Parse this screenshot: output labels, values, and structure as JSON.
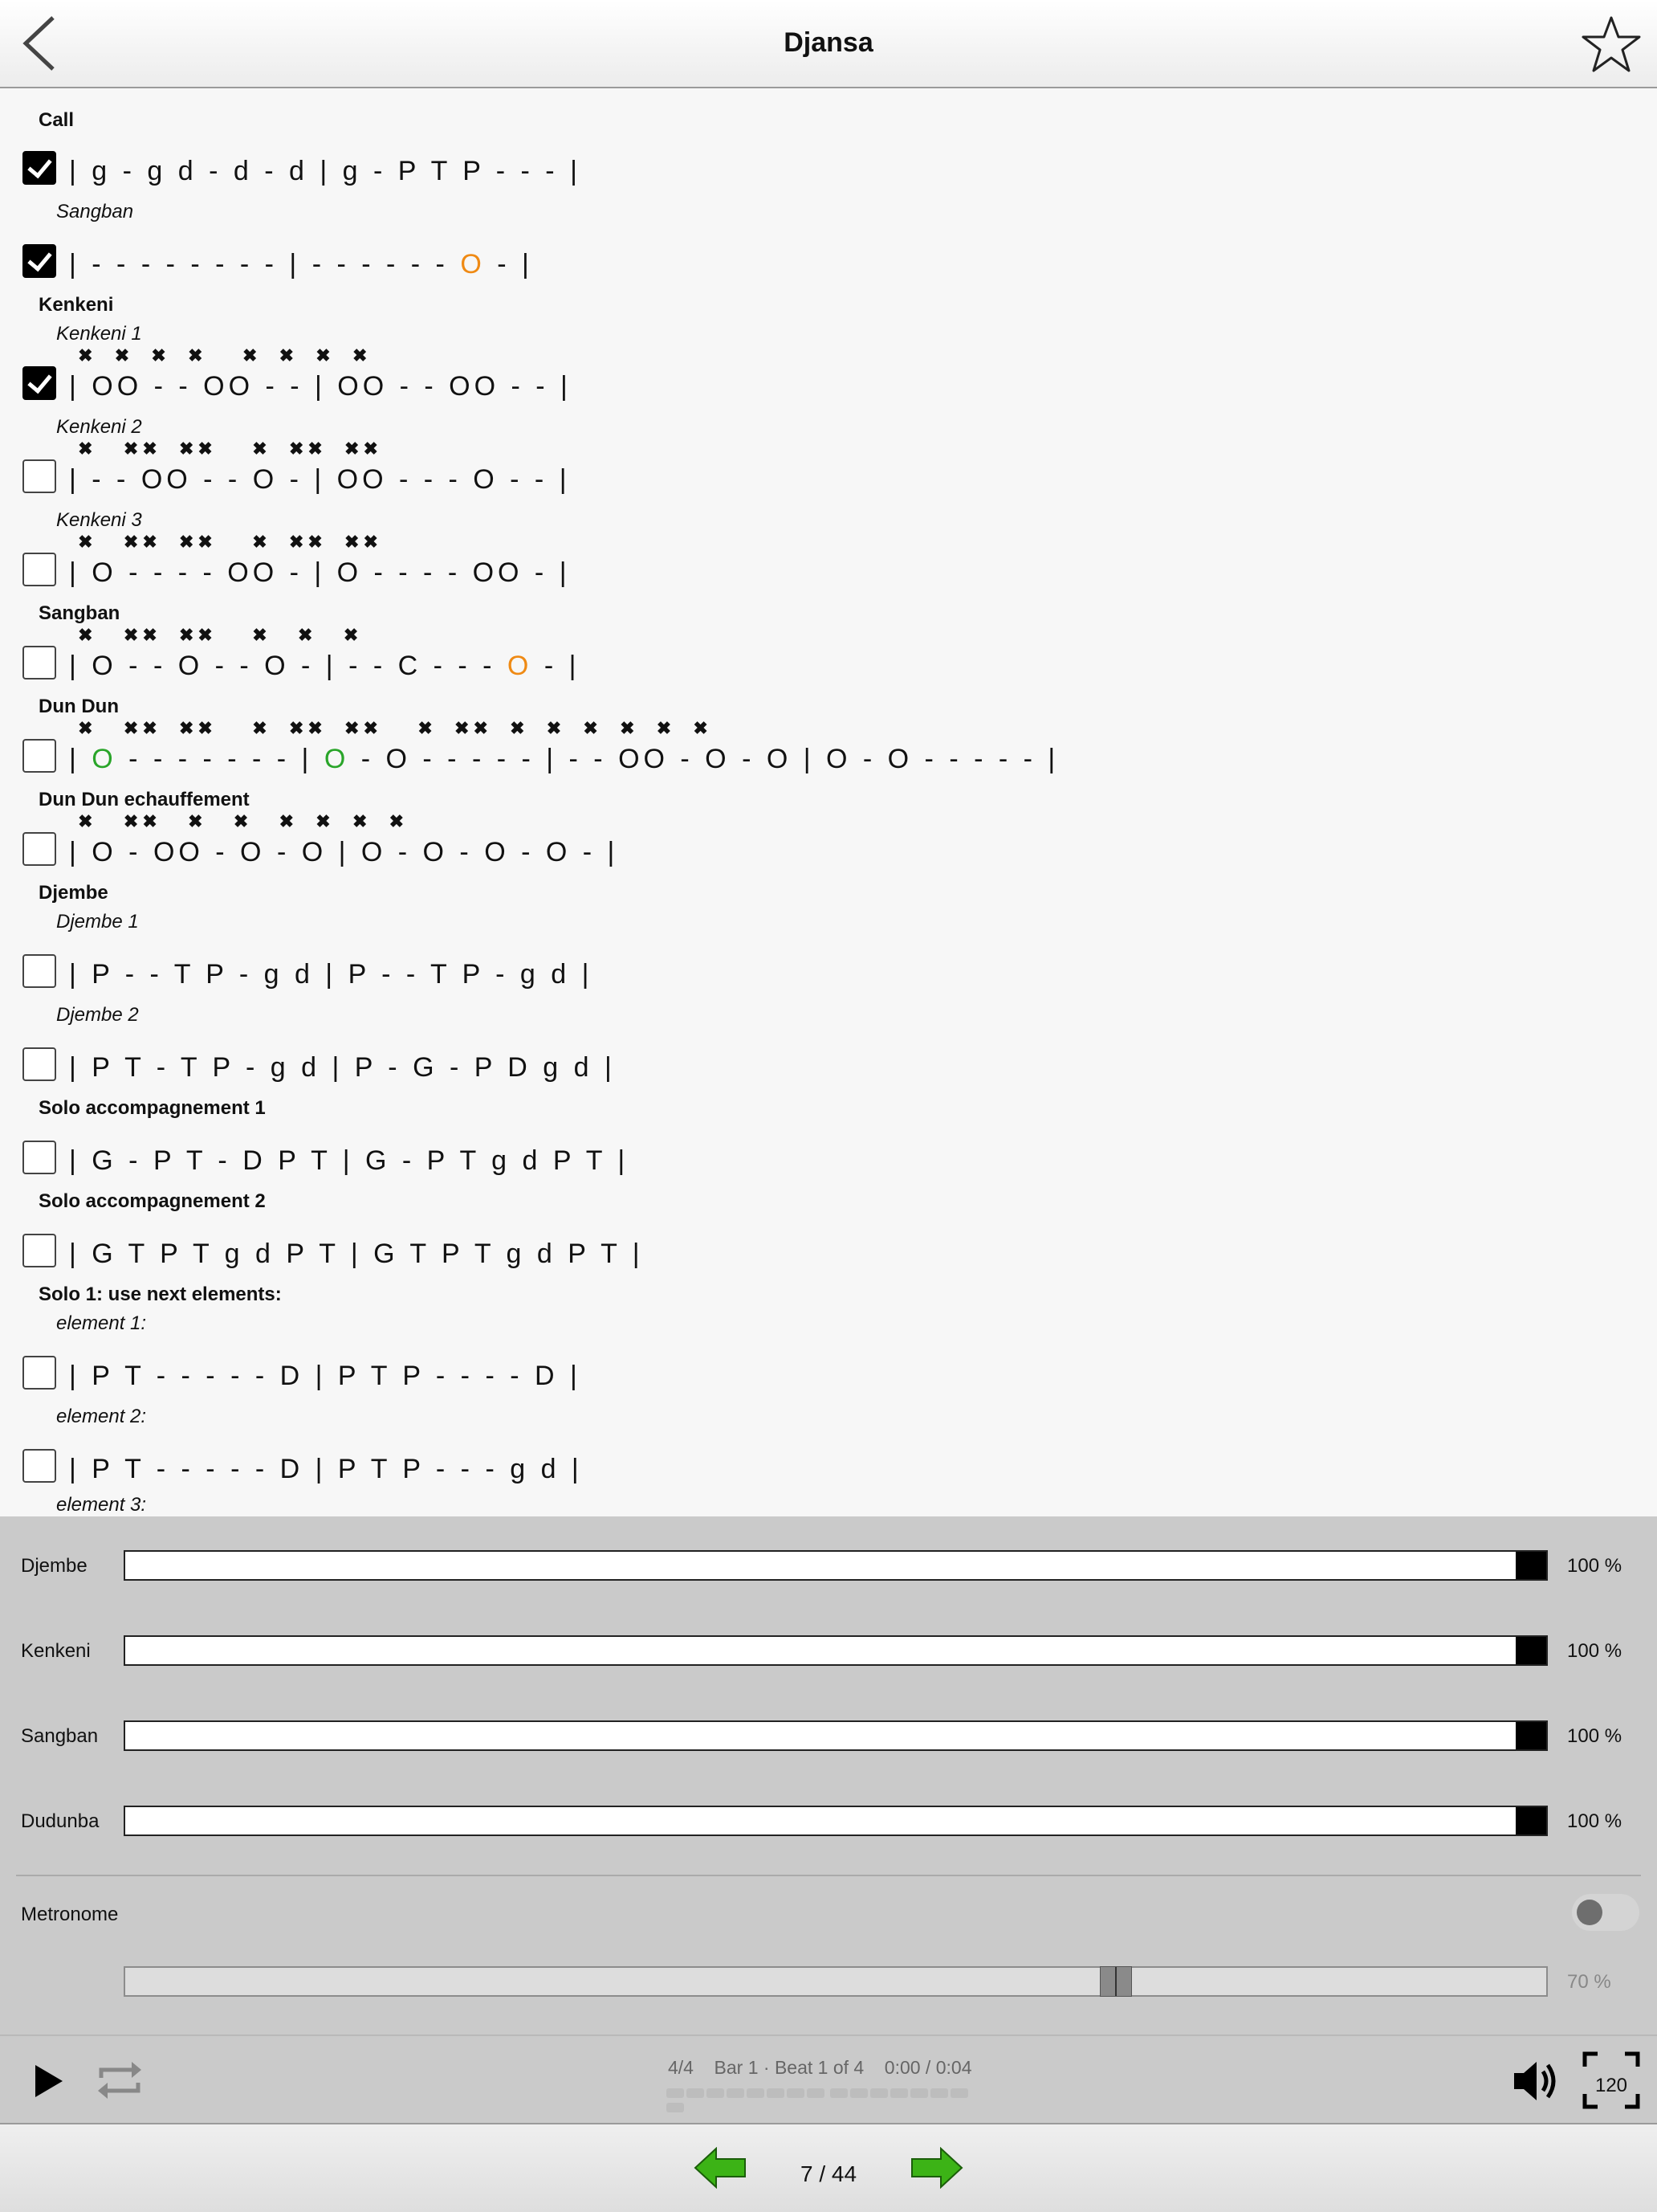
{
  "header": {
    "title": "Djansa"
  },
  "content": {
    "titles": {
      "call": "Call",
      "call_sub": "Sangban",
      "kenkeni": "Kenkeni",
      "kenkeni1": "Kenkeni 1",
      "kenkeni2": "Kenkeni 2",
      "kenkeni3": "Kenkeni 3",
      "sangban": "Sangban",
      "dundun": "Dun Dun",
      "dundun_ech": "Dun Dun echauffement",
      "djembe": "Djembe",
      "djembe1": "Djembe 1",
      "djembe2": "Djembe 2",
      "solo_acc1": "Solo accompagnement 1",
      "solo_acc2": "Solo accompagnement 2",
      "solo1": "Solo 1: use next elements:",
      "element1": "element 1:",
      "element2": "element 2:",
      "element3": "element 3:"
    },
    "rows": [
      {
        "checked": true,
        "marks": "",
        "pattern": "| g - g d - d - d | g - P T P - - - |"
      },
      {
        "checked": true,
        "marks": "",
        "pattern": "| - - - - - - - - | - - - - - - ",
        "orange": "O",
        "tail": " - |"
      },
      {
        "checked": true,
        "marks": " ✖  ✖  ✖  ✖    ✖  ✖  ✖  ✖",
        "pattern": "| OO - - OO - - | OO - - OO - - |"
      },
      {
        "checked": false,
        "marks": " ✖   ✖✖  ✖✖    ✖  ✖✖  ✖✖",
        "pattern": "| - - OO - - O - | OO - - - O - - |"
      },
      {
        "checked": false,
        "marks": " ✖   ✖✖  ✖✖    ✖  ✖✖  ✖✖",
        "pattern": "| O - - - - OO - | O - - - - OO - |"
      },
      {
        "checked": false,
        "marks": " ✖   ✖✖  ✖✖    ✖   ✖   ✖",
        "pattern": "| O - - O - - O - | - - C - - - ",
        "orange": "O",
        "tail": " - |"
      },
      {
        "checked": false,
        "marks": " ✖   ✖✖  ✖✖    ✖  ✖✖  ✖✖    ✖  ✖✖  ✖  ✖  ✖  ✖  ✖  ✖",
        "pre": "| ",
        "green": "O",
        "pattern": " - - - - - - - | ",
        "green2": "O",
        "tail": " - O - - - - - | - - OO - O - O | O - O - - - - - |"
      },
      {
        "checked": false,
        "marks": " ✖   ✖✖   ✖   ✖   ✖  ✖  ✖  ✖",
        "pattern": "| O - OO - O - O | O - O - O - O - |"
      },
      {
        "checked": false,
        "marks": "",
        "pattern": "| P - - T P - g d | P - - T P - g d |"
      },
      {
        "checked": false,
        "marks": "",
        "pattern": "| P T - T P - g d | P - G - P D g d |"
      },
      {
        "checked": false,
        "marks": "",
        "pattern": "| G - P T - D P T | G - P T g d P T |"
      },
      {
        "checked": false,
        "marks": "",
        "pattern": "| G T P T g d P T | G T P T g d P T |"
      },
      {
        "checked": false,
        "marks": "",
        "pattern": "| P T - - - - - D | P T P - - - - D |"
      },
      {
        "checked": false,
        "marks": "",
        "pattern": "| P T - - - - - D | P T P - - - g d |"
      }
    ]
  },
  "mixer": {
    "tracks": [
      {
        "label": "Djembe",
        "percent": "100 %",
        "level": 1.0
      },
      {
        "label": "Kenkeni",
        "percent": "100 %",
        "level": 1.0
      },
      {
        "label": "Sangban",
        "percent": "100 %",
        "level": 1.0
      },
      {
        "label": "Dudunba",
        "percent": "100 %",
        "level": 1.0
      }
    ],
    "metronome": {
      "label": "Metronome",
      "enabled": false,
      "percent": "70 %",
      "level": 0.7
    }
  },
  "transport": {
    "time_signature": "4/4",
    "position": "Bar 1 · Beat 1 of 4",
    "time": "0:00 / 0:04",
    "tempo": "120"
  },
  "footer": {
    "page": "7 / 44"
  },
  "colors": {
    "green": "#2aa52a",
    "orange": "#ef8a14",
    "arrow_green": "#3cb316"
  }
}
